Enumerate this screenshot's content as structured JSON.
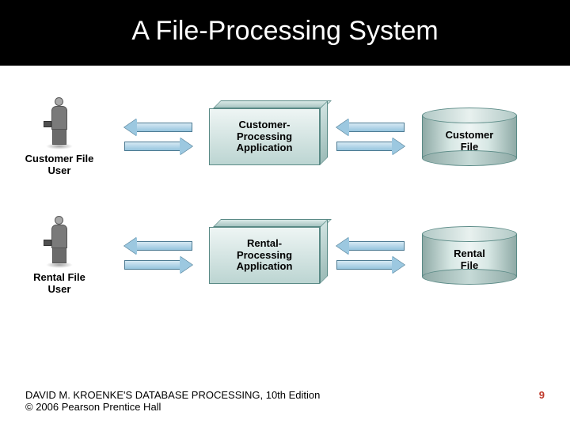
{
  "title": "A File-Processing System",
  "rows": [
    {
      "user_label_l1": "Customer File",
      "user_label_l2": "User",
      "app_label_l1": "Customer-",
      "app_label_l2": "Processing",
      "app_label_l3": "Application",
      "file_label_l1": "Customer",
      "file_label_l2": "File"
    },
    {
      "user_label_l1": "Rental File",
      "user_label_l2": "User",
      "app_label_l1": "Rental-",
      "app_label_l2": "Processing",
      "app_label_l3": "Application",
      "file_label_l1": "Rental",
      "file_label_l2": "File"
    }
  ],
  "footer": {
    "line1": "DAVID M. KROENKE'S DATABASE PROCESSING, 10th Edition",
    "line2": "© 2006 Pearson Prentice Hall",
    "page": "9"
  }
}
